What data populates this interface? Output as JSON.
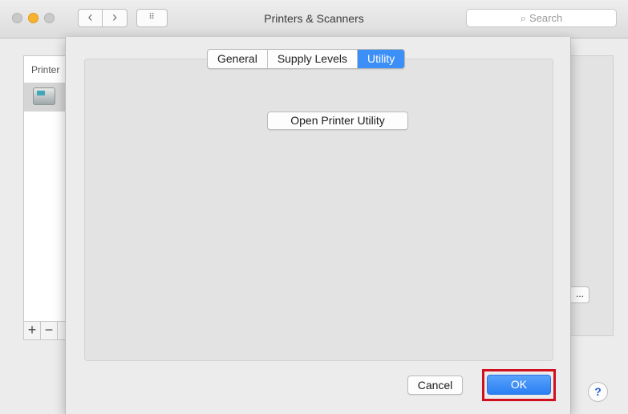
{
  "window": {
    "title": "Printers & Scanners",
    "nav_back": "‹",
    "nav_forward": "›",
    "grid_glyph": "⠿",
    "search_icon": "⌕",
    "search_placeholder": "Search"
  },
  "background": {
    "printer_list_header": "Printer",
    "ellipsis_button": "...",
    "add_button": "+",
    "remove_button": "−",
    "help_button": "?"
  },
  "sheet": {
    "tabs": [
      {
        "label": "General",
        "active": false
      },
      {
        "label": "Supply Levels",
        "active": false
      },
      {
        "label": "Utility",
        "active": true
      }
    ],
    "open_utility_label": "Open Printer Utility",
    "cancel_label": "Cancel",
    "ok_label": "OK"
  },
  "colors": {
    "accent": "#3d8ff8",
    "highlight": "#d0101f",
    "minimize": "#f6b230"
  }
}
